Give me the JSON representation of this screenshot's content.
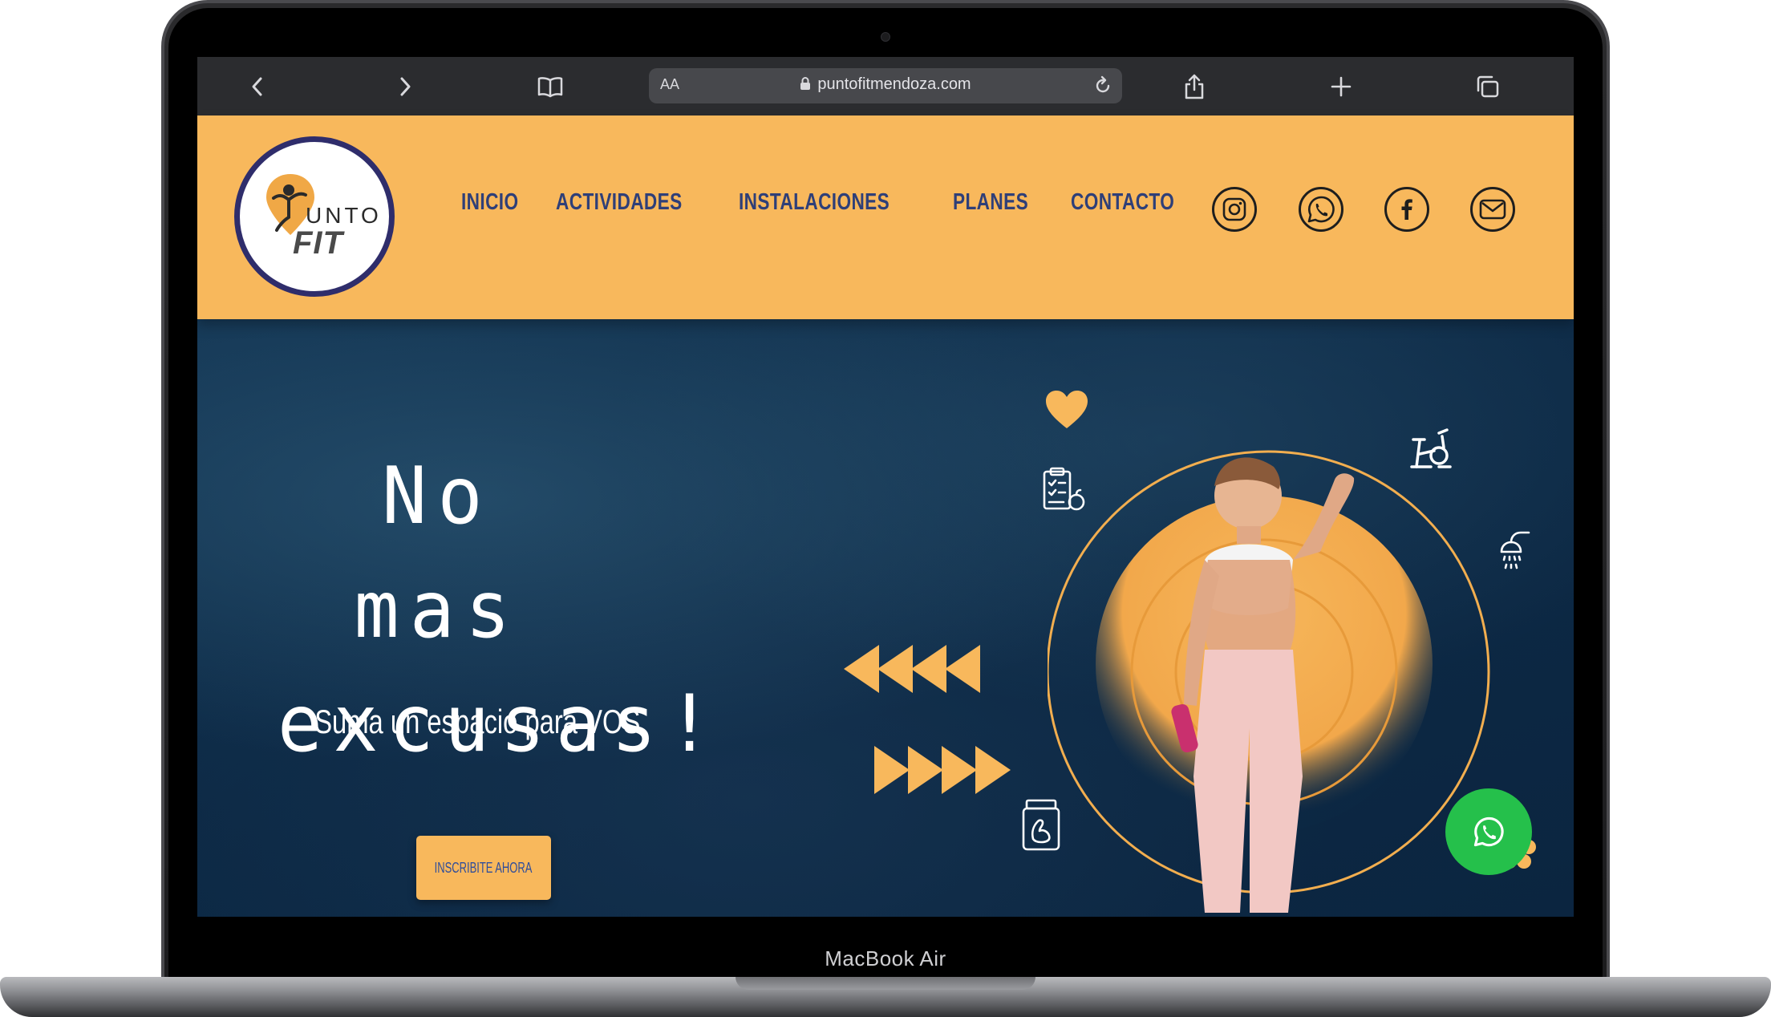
{
  "device": {
    "label": "MacBook Air"
  },
  "browser": {
    "text_size_label": "AA",
    "url": "puntofitmendoza.com",
    "icons": [
      "back-icon",
      "forward-icon",
      "bookmarks-icon",
      "lock-icon",
      "reload-icon",
      "share-icon",
      "new-tab-icon",
      "tabs-icon"
    ]
  },
  "site": {
    "logo": {
      "word_top": "UNTO",
      "word_bottom": "FIT"
    },
    "nav": [
      {
        "label": "INICIO"
      },
      {
        "label": "ACTIVIDADES"
      },
      {
        "label": "INSTALACIONES"
      },
      {
        "label": "PLANES"
      },
      {
        "label": "CONTACTO"
      }
    ],
    "social_icons": [
      "instagram-icon",
      "whatsapp-icon",
      "facebook-icon",
      "email-icon"
    ]
  },
  "hero": {
    "headline": "No mas\nexcusas!",
    "subheadline": "Suma un espacio para VOS",
    "cta_label": "INSCRIBITE AHORA",
    "decor_icons": [
      "heart-icon",
      "stationary-bike-icon",
      "clipboard-icon",
      "shower-icon",
      "supplement-jar-icon",
      "arrows-left-icon",
      "arrows-right-icon"
    ]
  },
  "floating_button": {
    "icon": "whatsapp-icon"
  },
  "colors": {
    "brand_yellow": "#f8b85c",
    "nav_blue": "#2f3f78",
    "hero_bg": "#0d2a46",
    "whatsapp_green": "#25c04b",
    "logo_ring": "#2f2d6b"
  }
}
